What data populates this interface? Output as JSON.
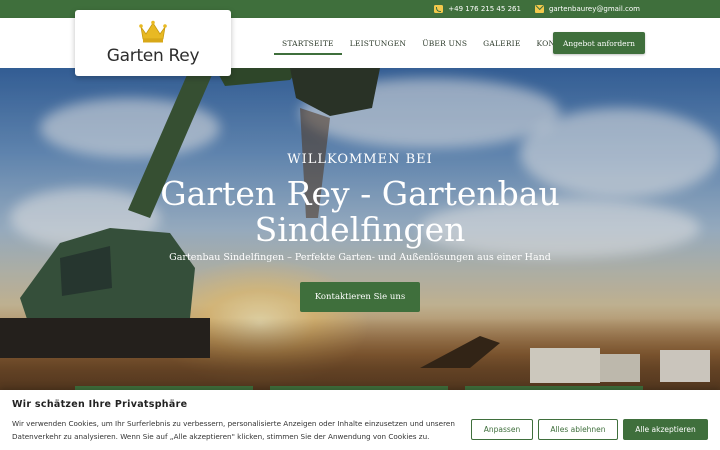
{
  "topbar": {
    "phone": "+49 176 215 45 261",
    "email": "gartenbaurey@gmail.com",
    "icons": {
      "phone": "phone-icon",
      "email": "mail-icon"
    }
  },
  "logo": {
    "text": "Garten Rey",
    "icon": "crown-icon"
  },
  "nav": {
    "items": [
      {
        "label": "STARTSEITE",
        "active": true
      },
      {
        "label": "LEISTUNGEN",
        "active": false
      },
      {
        "label": "ÜBER UNS",
        "active": false
      },
      {
        "label": "GALERIE",
        "active": false
      },
      {
        "label": "KONTAKT",
        "active": false
      }
    ],
    "cta": "Angebot anfordern"
  },
  "hero": {
    "eyebrow": "WILLKOMMEN BEI",
    "title": "Garten Rey - Gartenbau Sindelfingen",
    "subtitle": "Gartenbau Sindelfingen – Perfekte Garten- und Außenlösungen aus einer Hand",
    "button": "Kontaktieren Sie uns"
  },
  "cookie": {
    "title": "Wir schätzen Ihre Privatsphäre",
    "text": "Wir verwenden Cookies, um Ihr Surferlebnis zu verbessern, personalisierte Anzeigen oder Inhalte einzusetzen und unseren Datenverkehr zu analysieren. Wenn Sie auf „Alle akzeptieren\" klicken, stimmen Sie der Anwendung von Cookies zu.",
    "buttons": {
      "customize": "Anpassen",
      "reject": "Alles ablehnen",
      "accept": "Alle akzeptieren"
    }
  },
  "colors": {
    "brand": "#3f6f3c",
    "accent": "#f2c94c"
  }
}
